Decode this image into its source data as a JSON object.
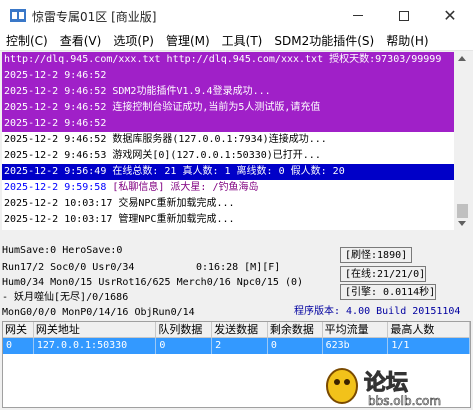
{
  "window": {
    "title": "惊雷专属01区 [商业版]",
    "minimize_label": "",
    "maximize_label": "",
    "close_label": "✕"
  },
  "menu": [
    "控制(C)",
    "查看(V)",
    "选项(P)",
    "管理(M)",
    "工具(T)",
    "SDM2功能插件(S)",
    "帮助(H)"
  ],
  "log": {
    "lines": [
      {
        "parts": [
          {
            "text": "http://dlq.945.com/xxx.txt http://dlq.945.com/xxx.txt 授权天数:97303/99999"
          }
        ],
        "style": "hl-purple"
      },
      {
        "parts": [
          {
            "text": "2025-12-2 9:46:52"
          }
        ],
        "style": "hl-purple"
      },
      {
        "parts": [
          {
            "text": "2025-12-2 9:46:52 SDM2功能插件V1.9.4登录成功..."
          }
        ],
        "style": "hl-purple"
      },
      {
        "parts": [
          {
            "text": "2025-12-2 9:46:52 连接控制台验证成功,当前为5人测试版,请充值"
          }
        ],
        "style": "hl-purple"
      },
      {
        "parts": [
          {
            "text": "2025-12-2 9:46:52"
          }
        ],
        "style": "hl-purple"
      },
      {
        "parts": [
          {
            "text": "2025-12-2 9:46:52 数据库服务器(127.0.0.1:7934)连接成功..."
          }
        ],
        "style": ""
      },
      {
        "parts": [
          {
            "text": "2025-12-2 9:46:53 游戏网关[0](127.0.0.1:50330)已打开..."
          }
        ],
        "style": ""
      },
      {
        "parts": [
          {
            "text": "2025-12-2 9:56:49 在线总数: 21 真人数: 1 离线数: 0 假人数: 20"
          }
        ],
        "style": "hl-blue"
      },
      {
        "parts": [
          {
            "text": "2025-12-2 9:59:58 ",
            "cls": "c-blue"
          },
          {
            "text": "[私聊信息] 派大星: /钓鱼海岛",
            "cls": "c-purple"
          }
        ],
        "style": ""
      },
      {
        "parts": [
          {
            "text": "2025-12-2 10:03:17 交易NPC重新加载完成..."
          }
        ],
        "style": ""
      },
      {
        "parts": [
          {
            "text": "2025-12-2 10:03:17 管理NPC重新加载完成..."
          }
        ],
        "style": ""
      }
    ]
  },
  "status": {
    "line1": "HumSave:0 HeroSave:0",
    "line2_left": "Run17/2 Soc0/0 Usr0/34",
    "time": "0:16:28 [M][F]",
    "line3": "Hum0/34 Mon0/15 UsrRot16/625 Merch0/16 Npc0/15 (0)",
    "line4": "- 妖月噬仙[无尽]/0/1686",
    "line5": "MonG0/0/0 MonP0/14/16 ObjRun0/14",
    "box_refresh": "[刷怪:1890]",
    "box_online": "[在线:21/21/0]",
    "box_engine": "[引擎: 0.0114秒]",
    "version": "程序版本: 4.00 Build 20151104"
  },
  "table": {
    "headers": [
      "网关",
      "网关地址",
      "队列数据",
      "发送数据",
      "剩余数据",
      "平均流量",
      "最高人数"
    ],
    "rows": [
      [
        "0",
        "127.0.0.1:50330",
        "0",
        "2",
        "0",
        "623b",
        "1/1"
      ]
    ]
  },
  "watermark": {
    "brand": "论坛",
    "url": "bbs.olb.com"
  }
}
